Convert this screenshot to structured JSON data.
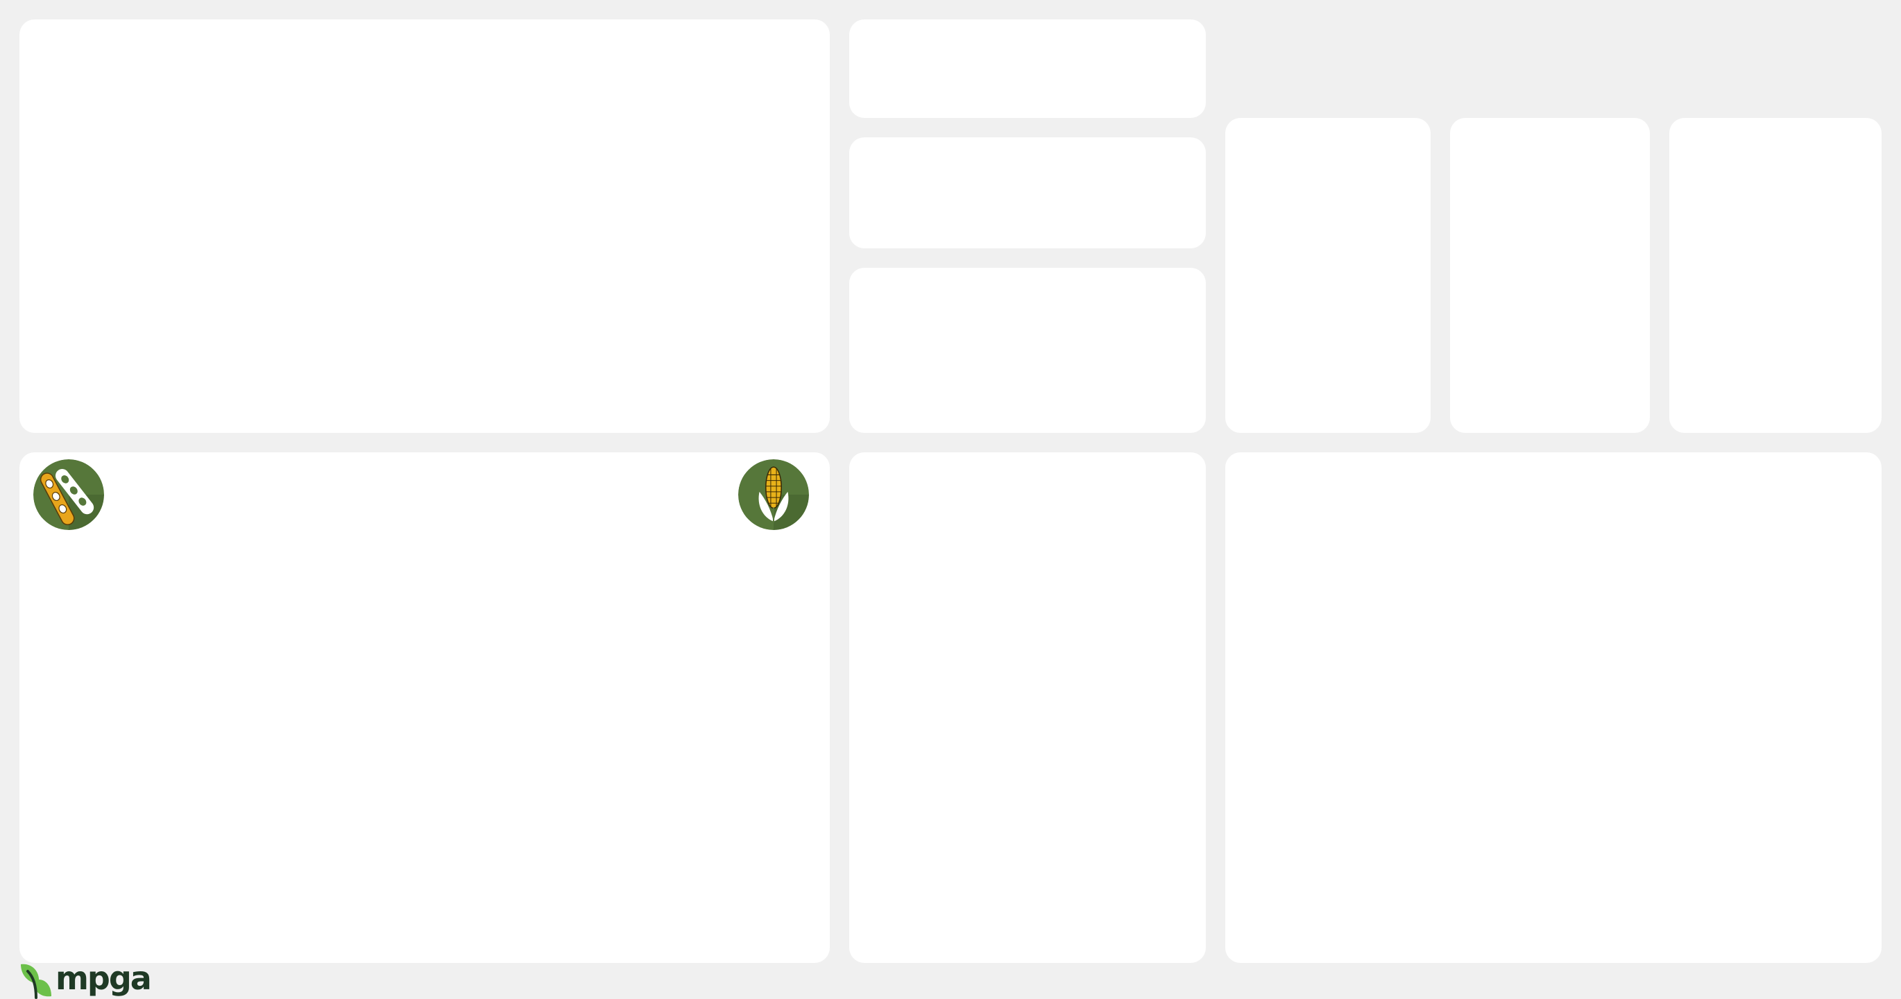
{
  "colors": {
    "background": "#f0f0f0",
    "card": "#ffffff",
    "icon_badge_green": "#56773a",
    "soybean_pod": "#e8a51c",
    "corn_kernel": "#e8b21a",
    "logo_green": "#6cc04a",
    "logo_text": "#1f3a25"
  },
  "cards": [
    {
      "name": "top-left-panel"
    },
    {
      "name": "middle-panel-1"
    },
    {
      "name": "middle-panel-2"
    },
    {
      "name": "middle-panel-3"
    },
    {
      "name": "small-panel-1"
    },
    {
      "name": "small-panel-2"
    },
    {
      "name": "small-panel-3"
    },
    {
      "name": "bottom-left-panel"
    },
    {
      "name": "bottom-middle-panel"
    },
    {
      "name": "bottom-right-panel"
    }
  ],
  "icons": {
    "soybean": "soybean-icon",
    "corn": "corn-icon",
    "logo": "mpga-logo-mark"
  },
  "footer": {
    "logo_text": "mpga"
  }
}
